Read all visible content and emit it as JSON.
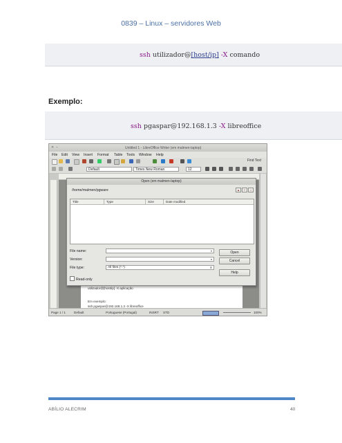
{
  "header": {
    "title": "0839 – Linux – servidores Web"
  },
  "commands": [
    {
      "cmd": "ssh",
      "user": "utilizador@",
      "host": "[host/ip]",
      "opt": "-X",
      "rest": "comando"
    },
    {
      "cmd": "ssh",
      "user": "pgaspar@192.168.1.3",
      "opt": "-X",
      "rest": "libreoffice"
    }
  ],
  "section_label": "Exemplo:",
  "screenshot": {
    "window_title": "Untitled 1 - LibreOffice Writer (em malmen-laptop)",
    "menu": [
      "File",
      "Edit",
      "View",
      "Insert",
      "Format",
      "Table",
      "Tools",
      "Window",
      "Help"
    ],
    "find_text": "Find Text",
    "paragraph_style": "Default",
    "font_name": "Times New Roman",
    "font_size": "12",
    "doc_lines": [
      "utilizador@[host/ip] -X aplicação",
      "Em exemplo:",
      "ssh pgaspar@192.168.1.3 -X libreoffice"
    ],
    "status": {
      "page": "Page 1 / 1",
      "style": "Default",
      "language": "Portuguese (Portugal)",
      "mode": "INSRT",
      "selection": "STD",
      "zoom": "100%"
    },
    "dialog": {
      "title": "Open (em malmen-laptop)",
      "path": "/home/malmen/pgware",
      "columns": [
        "Title",
        "Type",
        "Size",
        "Date modified"
      ],
      "file_name_label": "File name:",
      "version_label": "Version:",
      "file_type_label": "File type:",
      "file_type_value": "All files (*.*)",
      "open_label": "Open",
      "cancel_label": "Cancel",
      "help_label": "Help",
      "read_only_label": "Read-only"
    }
  },
  "footer": {
    "author": "ABÍLIO ALECRIM",
    "page": "40"
  }
}
